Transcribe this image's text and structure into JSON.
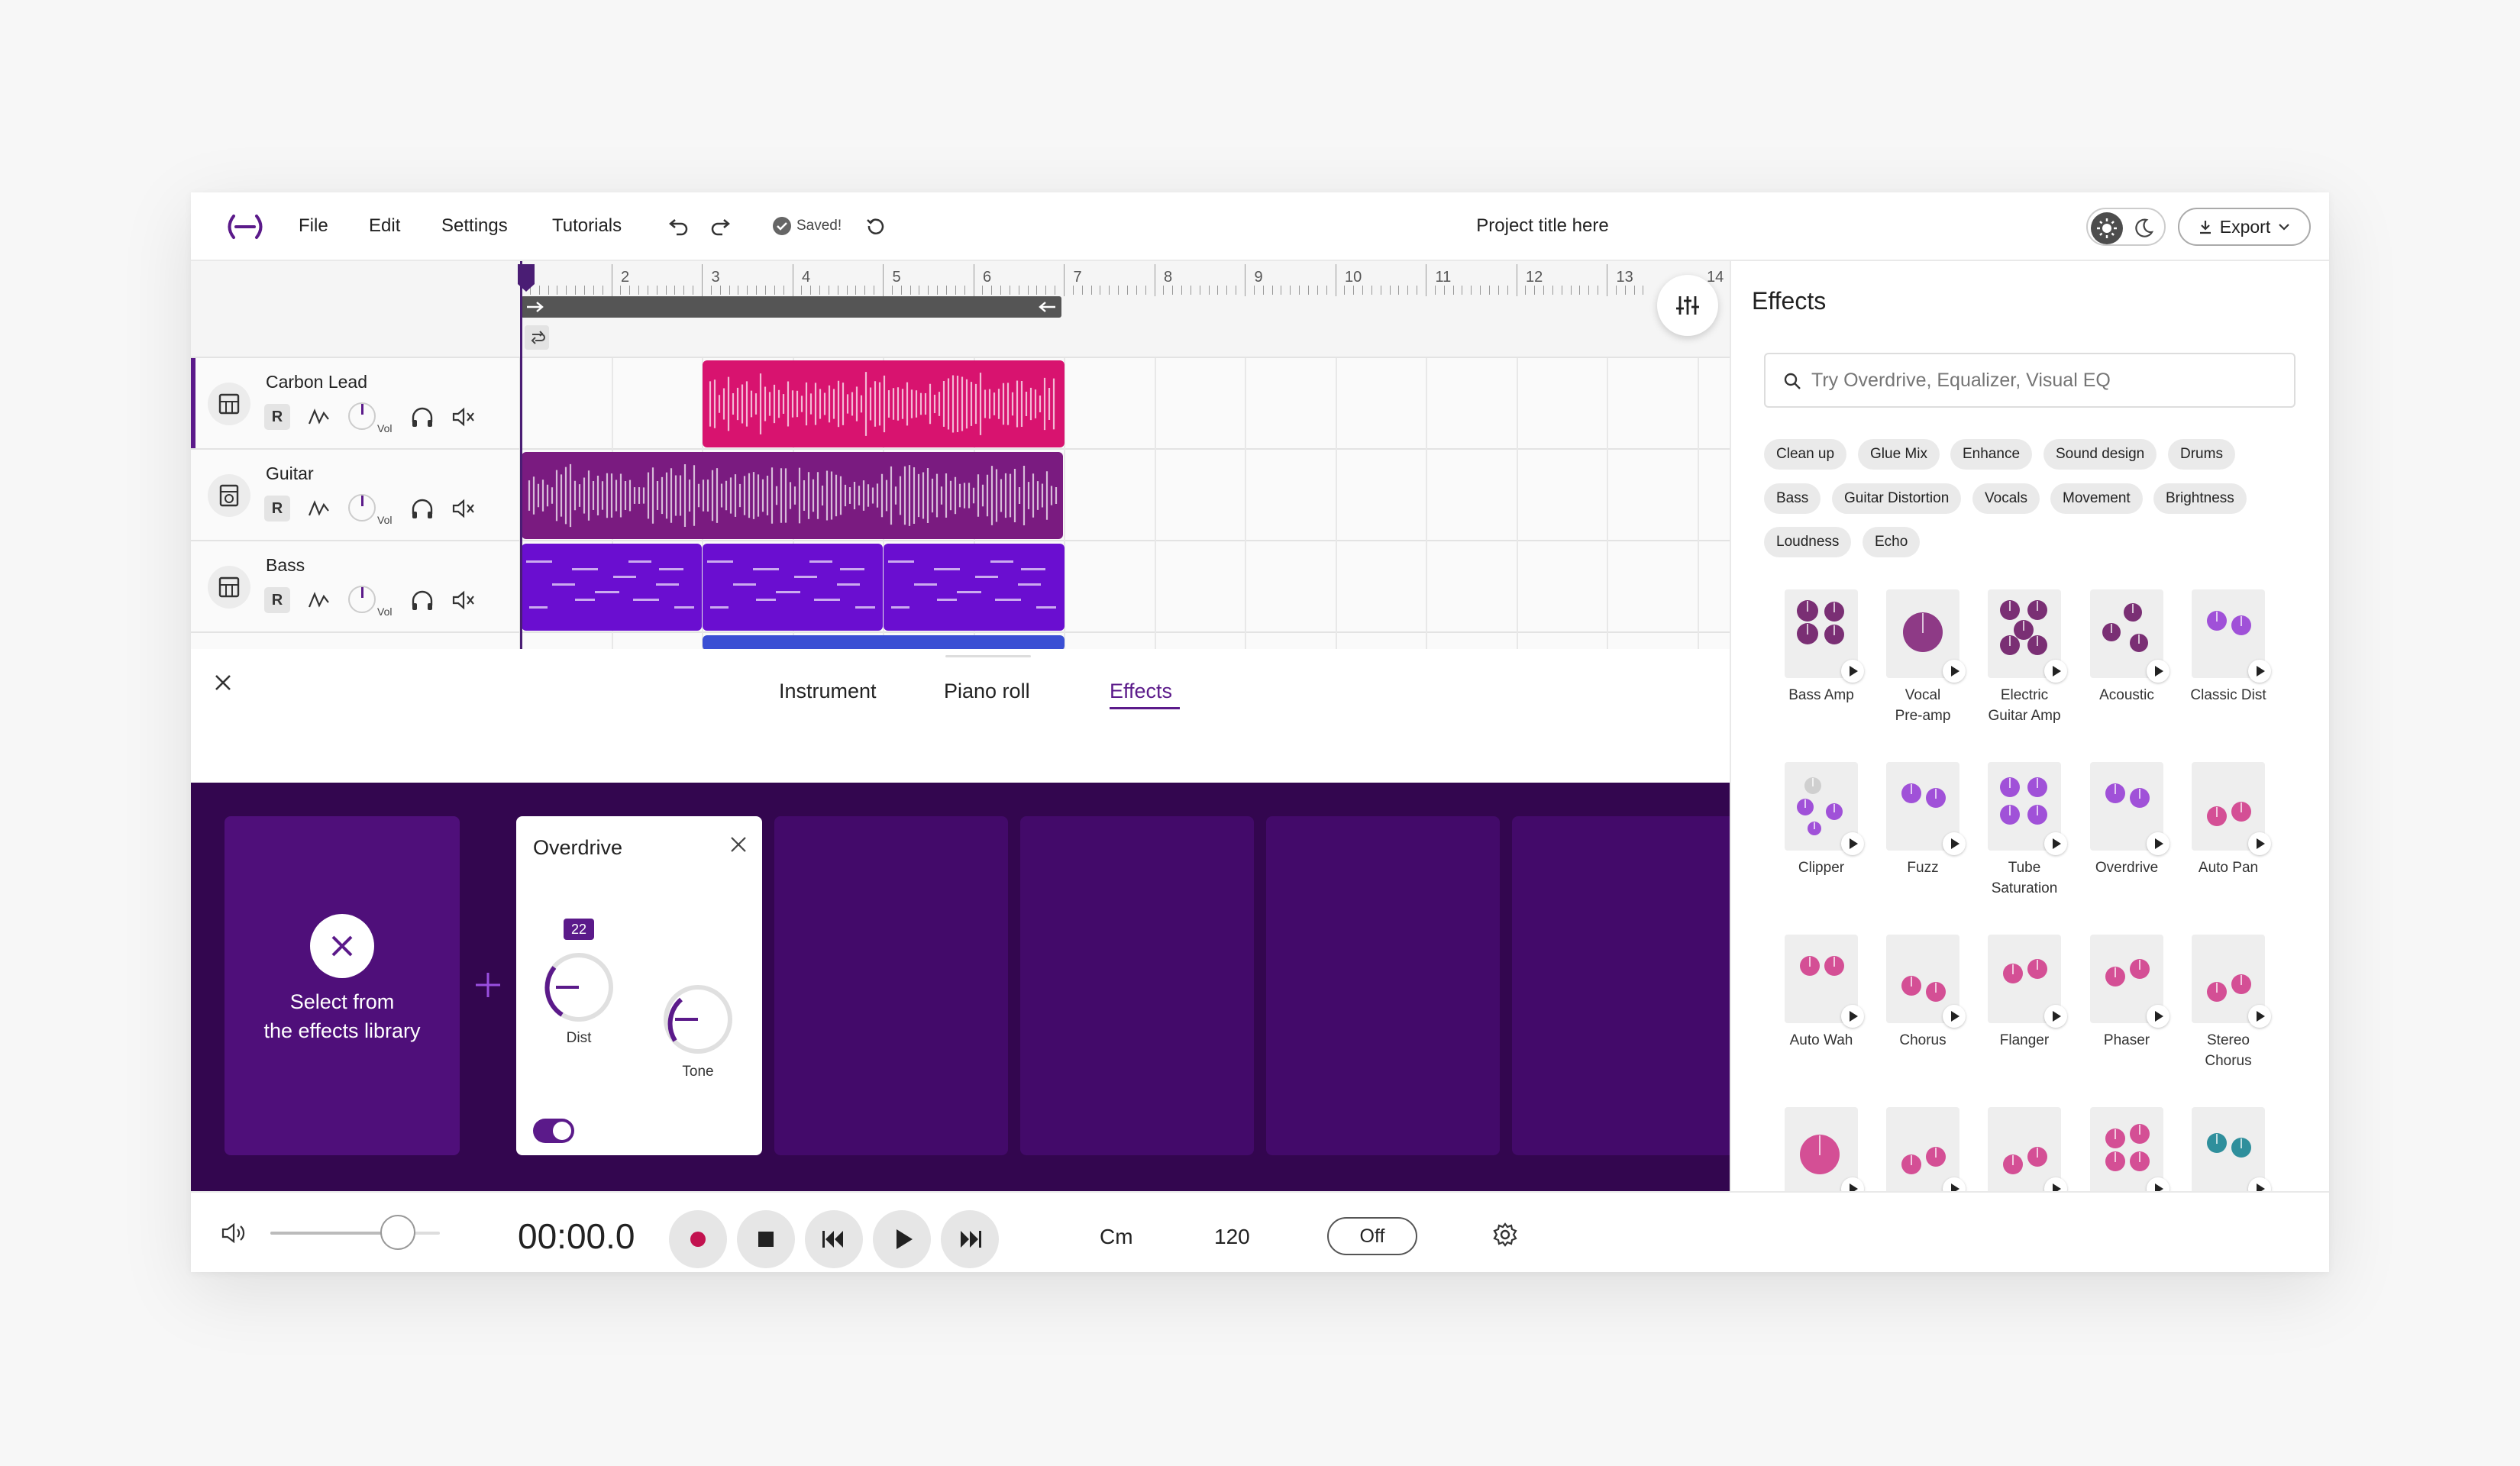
{
  "menu": {
    "file": "File",
    "edit": "Edit",
    "settings": "Settings",
    "tutorials": "Tutorials"
  },
  "status": {
    "saved": "Saved!"
  },
  "project": {
    "title": "Project title here"
  },
  "export": {
    "label": "Export"
  },
  "ruler": {
    "ticks": [
      "2",
      "3",
      "4",
      "5",
      "6",
      "7",
      "8",
      "9",
      "10",
      "11",
      "12",
      "13",
      "14"
    ]
  },
  "tracks": [
    {
      "name": "Carbon Lead",
      "vol": "Vol",
      "r": "R"
    },
    {
      "name": "Guitar",
      "vol": "Vol",
      "r": "R"
    },
    {
      "name": "Bass",
      "vol": "Vol",
      "r": "R"
    }
  ],
  "editor": {
    "tabs": [
      "Instrument",
      "Piano roll",
      "Effects"
    ],
    "active_tab": "Effects"
  },
  "rack": {
    "select_line1": "Select from",
    "select_line2": "the effects library",
    "overdrive": {
      "title": "Overdrive",
      "dist_value": "22",
      "dist_label": "Dist",
      "tone_label": "Tone",
      "enabled": true
    }
  },
  "sidebar": {
    "title": "Effects",
    "search_placeholder": "Try Overdrive, Equalizer, Visual EQ",
    "chips": [
      "Clean up",
      "Glue Mix",
      "Enhance",
      "Sound design",
      "Drums",
      "Bass",
      "Guitar Distortion",
      "Vocals",
      "Movement",
      "Brightness",
      "Loudness",
      "Echo"
    ],
    "effects": [
      {
        "line1": "Bass Amp",
        "line2": ""
      },
      {
        "line1": "Vocal",
        "line2": "Pre-amp"
      },
      {
        "line1": "Electric",
        "line2": "Guitar Amp"
      },
      {
        "line1": "Acoustic",
        "line2": ""
      },
      {
        "line1": "Classic Dist",
        "line2": ""
      },
      {
        "line1": "Clipper",
        "line2": ""
      },
      {
        "line1": "Fuzz",
        "line2": ""
      },
      {
        "line1": "Tube",
        "line2": "Saturation"
      },
      {
        "line1": "Overdrive",
        "line2": ""
      },
      {
        "line1": "Auto Pan",
        "line2": ""
      },
      {
        "line1": "Auto Wah",
        "line2": ""
      },
      {
        "line1": "Chorus",
        "line2": ""
      },
      {
        "line1": "Flanger",
        "line2": ""
      },
      {
        "line1": "Phaser",
        "line2": ""
      },
      {
        "line1": "Stereo",
        "line2": "Chorus"
      }
    ]
  },
  "transport": {
    "time": "00:00.0",
    "key": "Cm",
    "tempo": "120",
    "metronome": "Off",
    "volume_level": 0.75
  },
  "colors": {
    "accent": "#5b1a8a",
    "lead_clip": "#d8136f",
    "guitar_clip": "#7a1b80",
    "bass_clip": "#6a0ed0",
    "rack_bg": "#33064f",
    "record": "#c2124f"
  }
}
